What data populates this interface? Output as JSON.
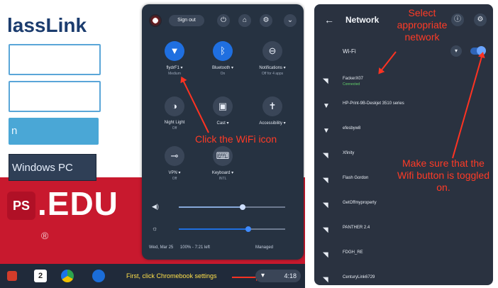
{
  "left_screen": {
    "logo_text": "lassLink",
    "login_button_label": "n",
    "windows_button_label": "Windows PC",
    "edu_badge": "PS",
    "edu_text": ".EDU",
    "registered": "®"
  },
  "shelf": {
    "caption": "First, click Chromebook settings",
    "clock": "4:18"
  },
  "quick_settings": {
    "sign_out": "Sign out",
    "top_icons": [
      "power-icon",
      "lock-icon",
      "gear-icon",
      "chevron-down-icon"
    ],
    "tiles": [
      {
        "label": "flydrF1 ▾",
        "sub": "Medium",
        "icon": "wifi-icon",
        "on": true
      },
      {
        "label": "Bluetooth ▾",
        "sub": "On",
        "icon": "bluetooth-icon",
        "on": true
      },
      {
        "label": "Notifications ▾",
        "sub": "Off for 4 apps",
        "icon": "notifications-icon",
        "on": false
      },
      {
        "label": "Night Light",
        "sub": "Off",
        "icon": "night-light-icon",
        "on": false
      },
      {
        "label": "Cast ▾",
        "sub": "",
        "icon": "cast-icon",
        "on": false
      },
      {
        "label": "Accessibility ▾",
        "sub": "",
        "icon": "accessibility-icon",
        "on": false
      },
      {
        "label": "VPN ▾",
        "sub": "Off",
        "icon": "vpn-key-icon",
        "on": false
      },
      {
        "label": "Keyboard ▾",
        "sub": "INTL",
        "icon": "keyboard-icon",
        "on": false
      }
    ],
    "volume_level": 0.6,
    "brightness_level": 0.65,
    "date": "Wed, Mar 25",
    "battery": "100% - 7:21 left",
    "managed": "Managed"
  },
  "annotations": {
    "click_wifi": "Click the WiFi icon",
    "select_network": "Select appropriate network",
    "toggle_note": "Make sure that the Wifi button is toggled on."
  },
  "network_panel": {
    "title": "Network",
    "wifi_label": "Wi-Fi",
    "wifi_enabled": true,
    "networks": [
      {
        "name": "FackerX07",
        "status": "Connected"
      },
      {
        "name": "HP-Print-9B-Deskjet 3510 series",
        "status": ""
      },
      {
        "name": "efesbyw8",
        "status": ""
      },
      {
        "name": "Xfinity",
        "status": ""
      },
      {
        "name": "Flash Gordon",
        "status": ""
      },
      {
        "name": "GetOffmyproperty",
        "status": ""
      },
      {
        "name": "PANTHER 2.4",
        "status": ""
      },
      {
        "name": "FDGH_RE",
        "status": ""
      },
      {
        "name": "CenturyLink6729",
        "status": ""
      }
    ]
  },
  "colors": {
    "annotation": "#ff3b26",
    "toggle_on": "#2f65b8",
    "panel_bg": "#263241"
  }
}
